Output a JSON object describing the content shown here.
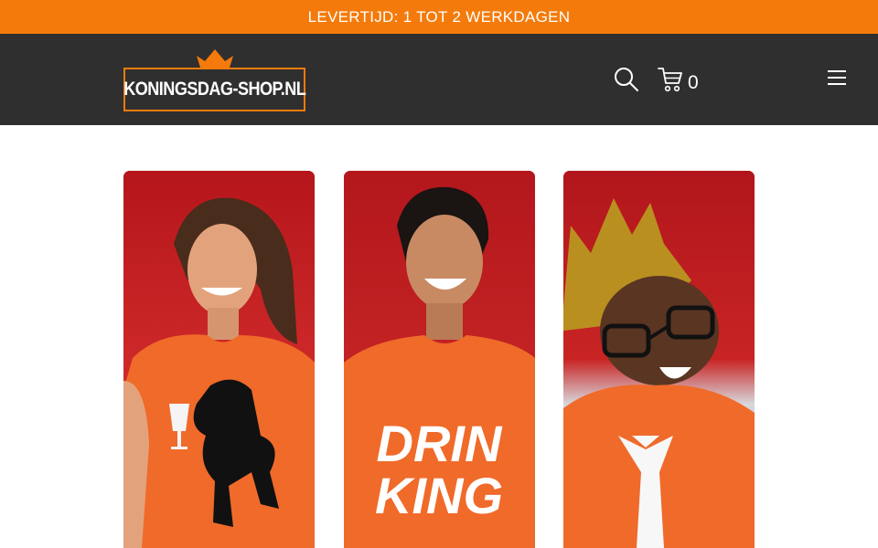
{
  "announcement": {
    "text": "LEVERTIJD: 1 TOT 2 WERKDAGEN"
  },
  "header": {
    "logo_text": "KONINGSDAG-SHOP.NL",
    "cart_count": "0",
    "icons": {
      "search": "search-icon",
      "cart": "cart-icon",
      "menu": "hamburger-menu-icon",
      "crown": "crown-icon"
    }
  },
  "products": [
    {
      "image": "woman-orange-shirt-lion",
      "shirt_print": ""
    },
    {
      "image": "man-orange-shirt-drinking",
      "shirt_print_line1": "DRIN",
      "shirt_print_line2": "KING"
    },
    {
      "image": "child-orange-shirt-crown-tie",
      "shirt_print": ""
    }
  ],
  "colors": {
    "brand_orange": "#f47b0b",
    "header_dark": "#2f2f2f",
    "banner_red": "#c41e1e",
    "shirt_orange": "#f06a2a"
  }
}
